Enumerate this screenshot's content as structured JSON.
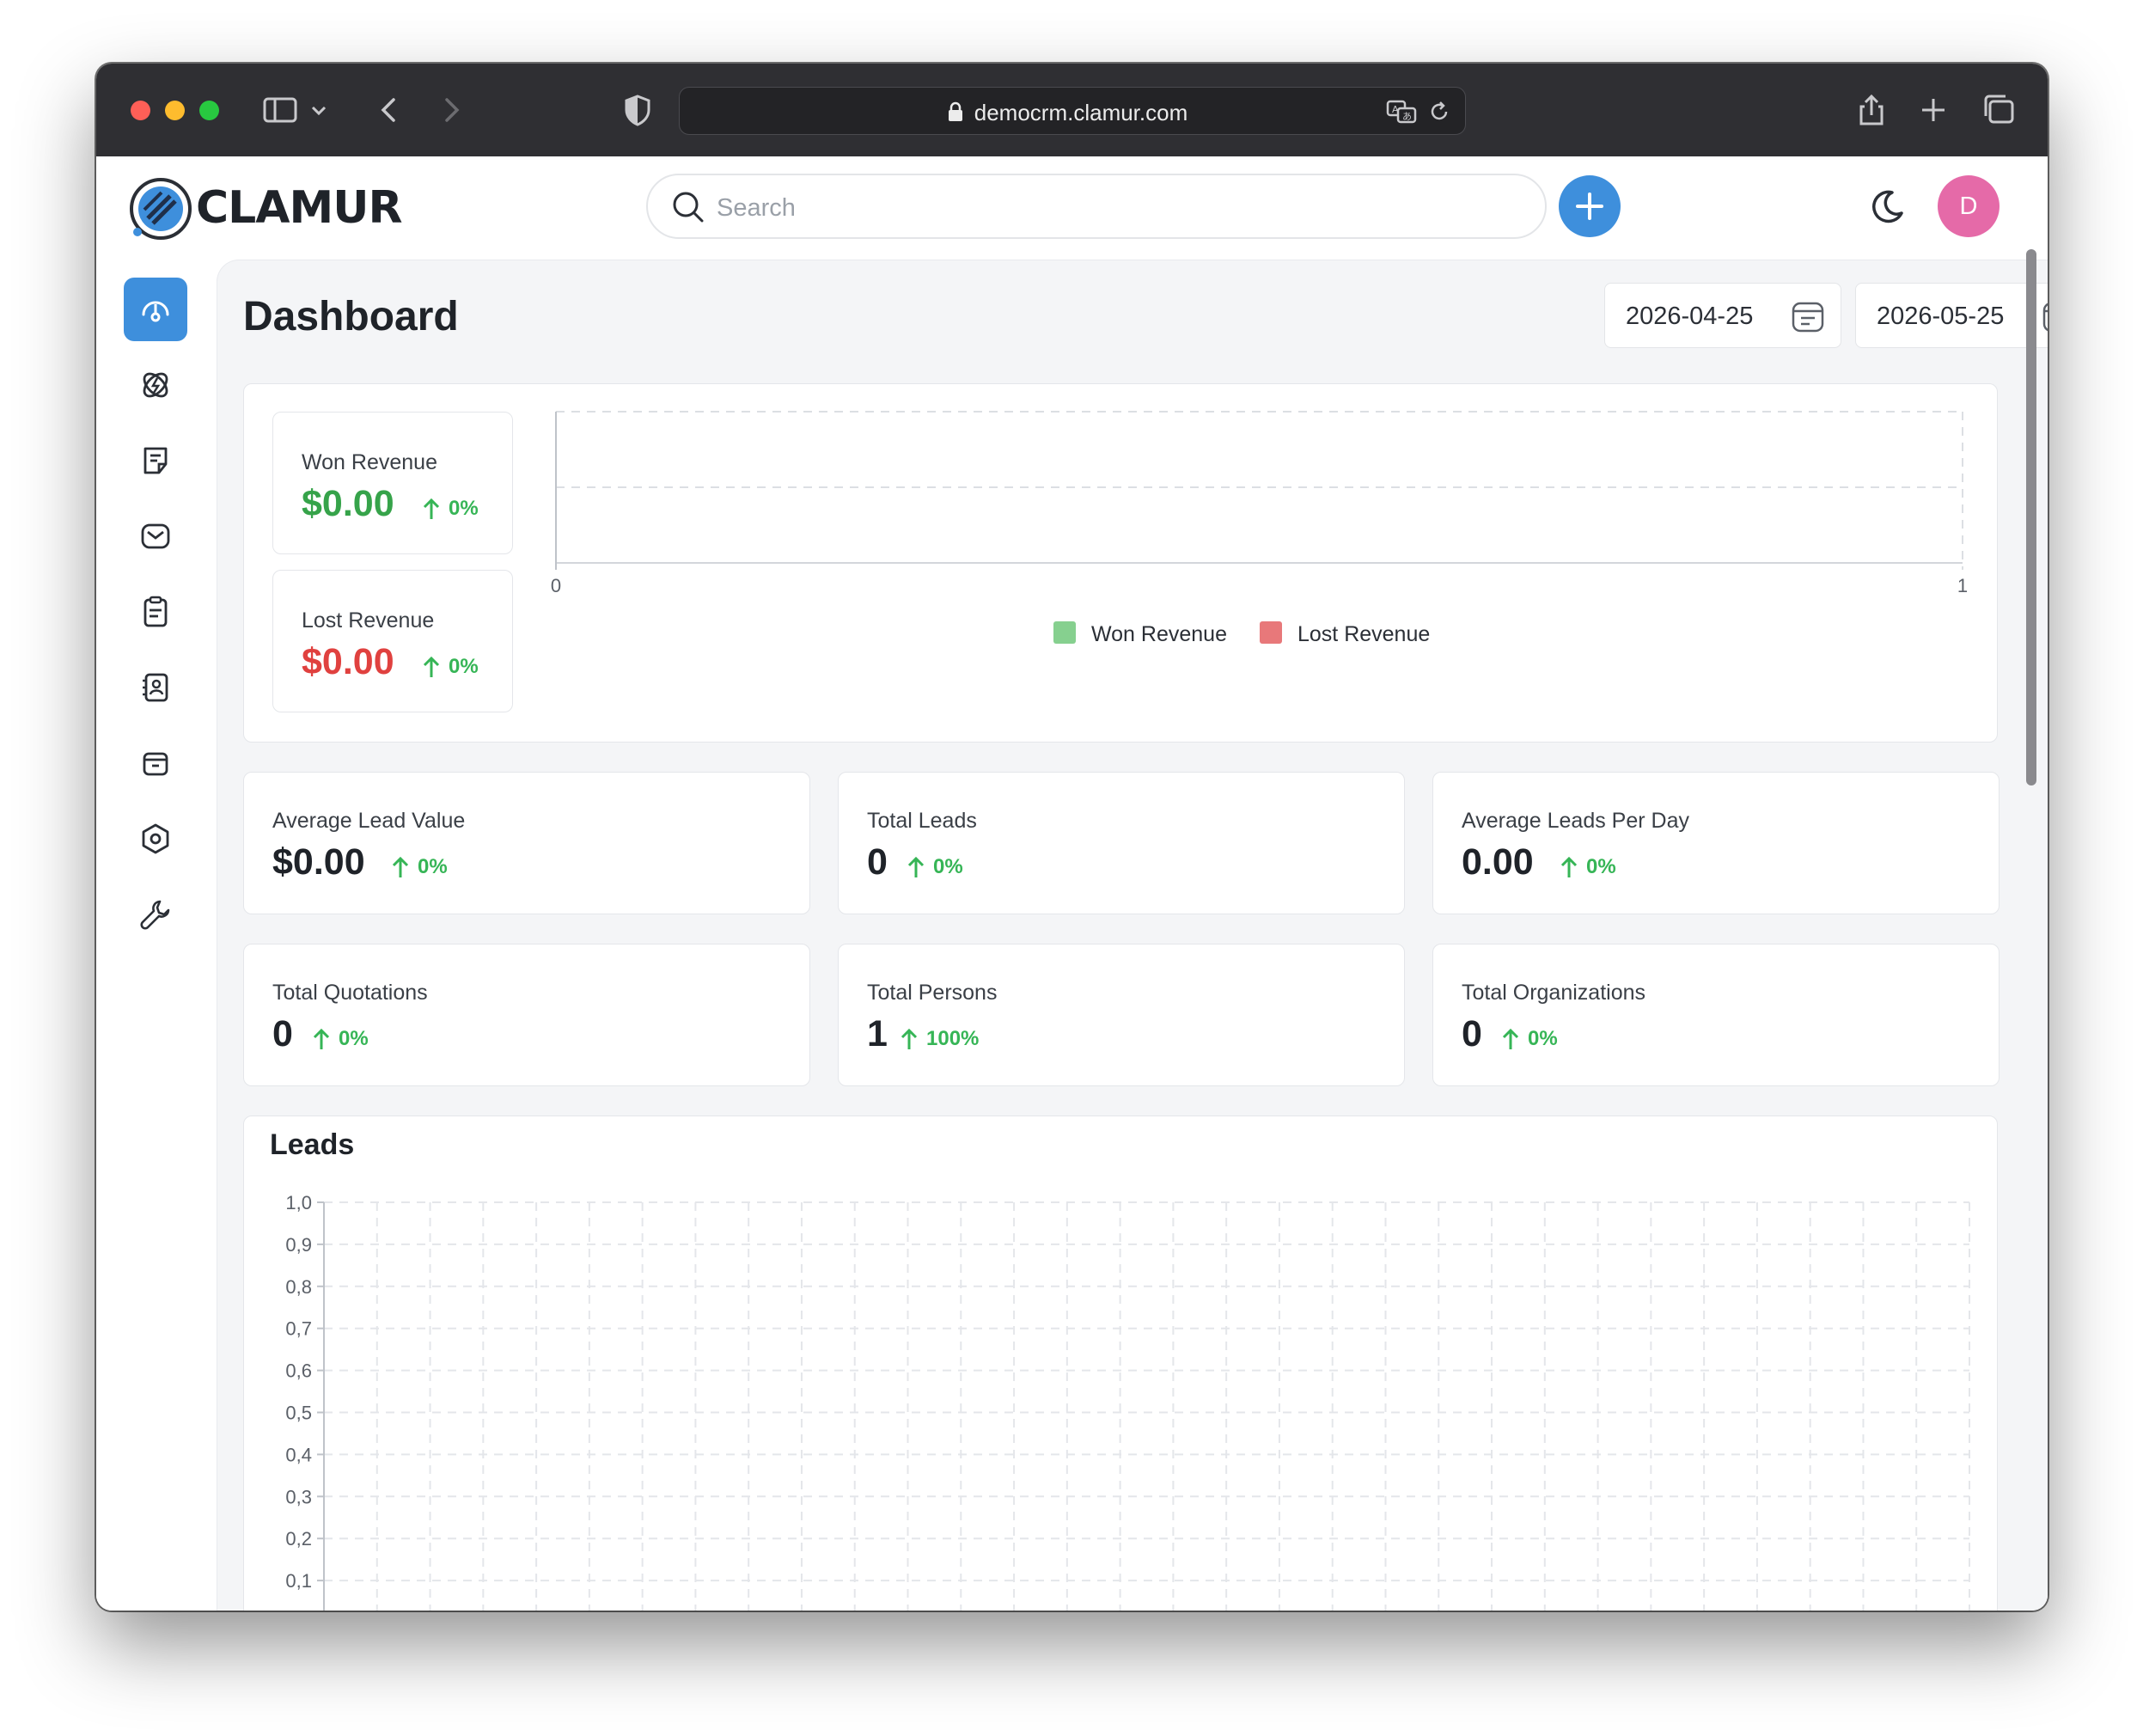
{
  "browser": {
    "url": "democrm.clamur.com",
    "traffic_colors": [
      "#ff5f57",
      "#febc2e",
      "#28c840"
    ]
  },
  "app": {
    "brand": "CLAMUR",
    "search_placeholder": "Search",
    "avatar_initial": "D",
    "accent": "#3e8fdc",
    "avatar_color": "#e56aa8"
  },
  "sidebar": {
    "items": [
      {
        "icon": "dashboard-icon",
        "active": true
      },
      {
        "icon": "leads-icon",
        "active": false
      },
      {
        "icon": "quotes-icon",
        "active": false
      },
      {
        "icon": "mail-icon",
        "active": false
      },
      {
        "icon": "activities-icon",
        "active": false
      },
      {
        "icon": "contacts-icon",
        "active": false
      },
      {
        "icon": "products-icon",
        "active": false
      },
      {
        "icon": "settings-icon",
        "active": false
      },
      {
        "icon": "configuration-icon",
        "active": false
      }
    ]
  },
  "dashboard": {
    "title": "Dashboard",
    "date_start": "2026-04-25",
    "date_end": "2026-05-25",
    "won_revenue": {
      "label": "Won Revenue",
      "value": "$0.00",
      "change": "0%"
    },
    "lost_revenue": {
      "label": "Lost Revenue",
      "value": "$0.00",
      "change": "0%"
    },
    "stats": [
      {
        "label": "Average Lead Value",
        "value": "$0.00",
        "change": "0%"
      },
      {
        "label": "Total Leads",
        "value": "0",
        "change": "0%"
      },
      {
        "label": "Average Leads Per Day",
        "value": "0.00",
        "change": "0%"
      },
      {
        "label": "Total Quotations",
        "value": "0",
        "change": "0%"
      },
      {
        "label": "Total Persons",
        "value": "1",
        "change": "100%"
      },
      {
        "label": "Total Organizations",
        "value": "0",
        "change": "0%"
      }
    ],
    "leads_title": "Leads"
  },
  "chart_data": [
    {
      "type": "bar",
      "x_ticks": [
        "0",
        "1"
      ],
      "series": [
        {
          "name": "Won Revenue",
          "values": [],
          "color": "#86d08f"
        },
        {
          "name": "Lost Revenue",
          "values": [],
          "color": "#e8787a"
        }
      ],
      "legend": "bottom",
      "grid": true
    },
    {
      "type": "line",
      "title": "Leads",
      "y_ticks": [
        "1,0",
        "0,9",
        "0,8",
        "0,7",
        "0,6",
        "0,5",
        "0,4",
        "0,3",
        "0,2",
        "0,1"
      ],
      "ylim": [
        0,
        1
      ],
      "series": [],
      "grid": true
    }
  ]
}
